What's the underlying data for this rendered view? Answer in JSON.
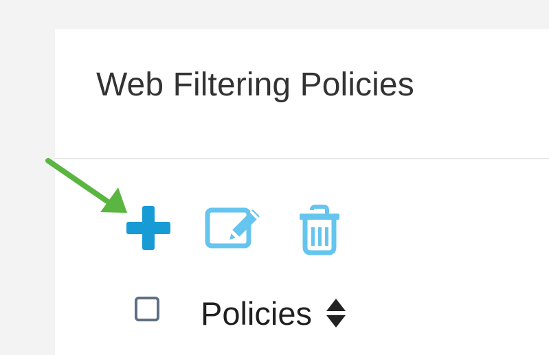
{
  "page": {
    "title": "Web Filtering Policies"
  },
  "toolbar": {
    "add_icon": "plus-icon",
    "edit_icon": "edit-icon",
    "delete_icon": "trash-icon"
  },
  "table": {
    "select_all": "checkbox",
    "columns": [
      {
        "label": "Policies",
        "sort_icon": "sort-icon"
      }
    ]
  },
  "colors": {
    "accent_blue": "#169bd5",
    "light_blue": "#6dc6ec",
    "annotation_green": "#5ab640",
    "text_dark": "#333333"
  }
}
